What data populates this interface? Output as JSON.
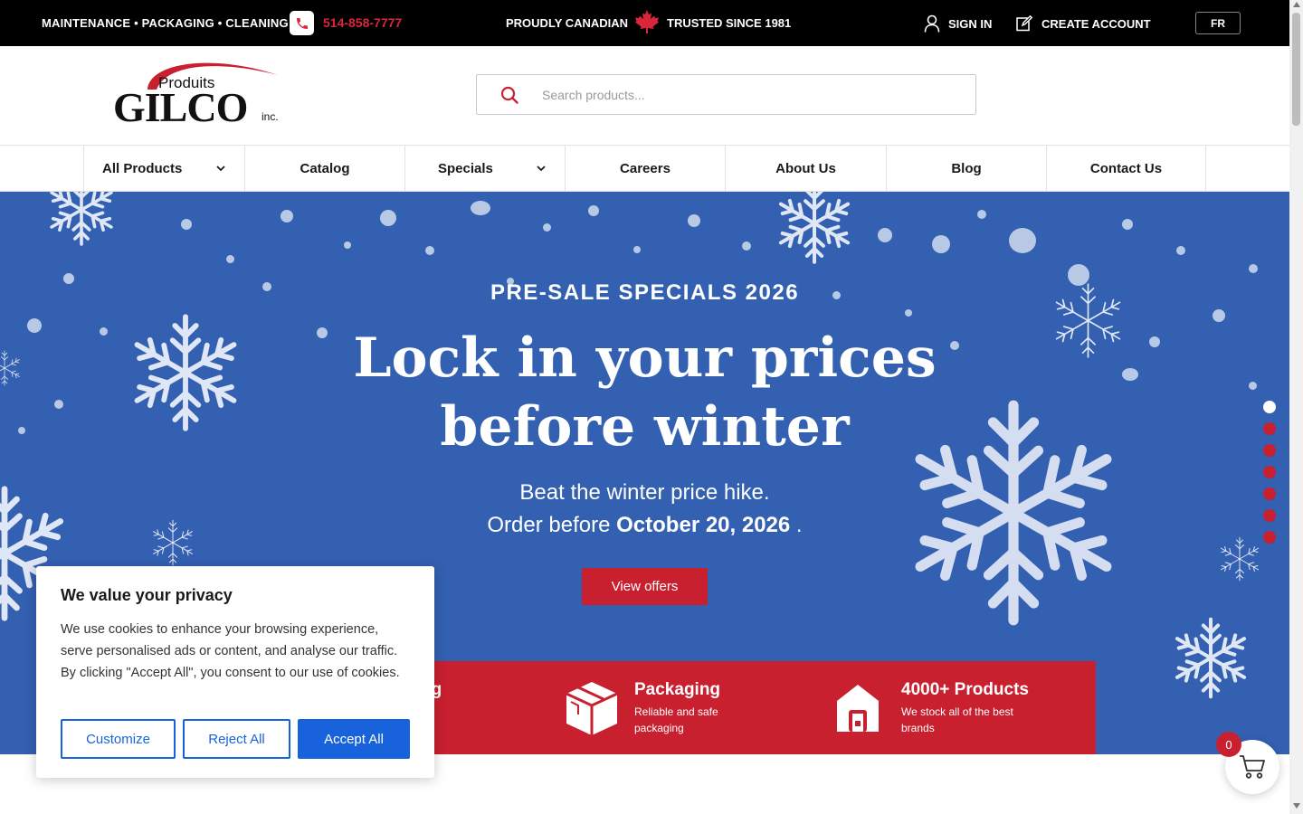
{
  "topbar": {
    "tagline": "MAINTENANCE • PACKAGING • CLEANING",
    "phone": "514-858-7777",
    "proudly": "PROUDLY CANADIAN",
    "trusted": "TRUSTED SINCE 1981",
    "sign_in": "SIGN IN",
    "create_account": "CREATE ACCOUNT",
    "language": "FR"
  },
  "logo": {
    "line1": "Produits",
    "line2": "GILCO",
    "line3": "inc."
  },
  "search": {
    "placeholder": "Search products..."
  },
  "nav": {
    "items": [
      {
        "label": "All Products"
      },
      {
        "label": "Catalog"
      },
      {
        "label": "Specials"
      },
      {
        "label": "Careers"
      },
      {
        "label": "About Us"
      },
      {
        "label": "Blog"
      },
      {
        "label": "Contact Us"
      }
    ]
  },
  "hero": {
    "kicker": "PRE-SALE SPECIALS 2026",
    "headline_line1": "Lock in your prices",
    "headline_line2": "before winter",
    "sub_line1": "Beat the winter price hike.",
    "sub_prefix": "Order before",
    "sub_date": "October 20, 2026",
    "sub_suffix": ".",
    "cta": "View offers",
    "slides_total": 7,
    "slide_active": 1
  },
  "features": [
    {
      "title": "ng",
      "desc": ""
    },
    {
      "title": "Packaging",
      "desc": "Reliable and safe packaging"
    },
    {
      "title": "4000+ Products",
      "desc": "We stock all of the best brands"
    }
  ],
  "cookie": {
    "title": "We value your privacy",
    "text": "We use cookies to enhance your browsing experience, serve personalised ads or content, and analyse our traffic. By clicking \"Accept All\", you consent to our use of cookies.",
    "customize": "Customize",
    "reject": "Reject All",
    "accept": "Accept All"
  },
  "cart": {
    "count": "0"
  },
  "colors": {
    "brand_red": "#c8202f",
    "hero_blue": "#3360b1",
    "cookie_blue": "#1863dc"
  }
}
